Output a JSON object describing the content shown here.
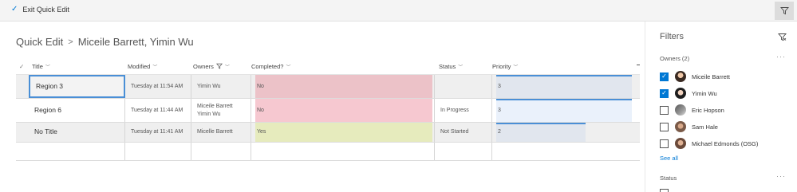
{
  "toolbar": {
    "exit_label": "Exit Quick Edit",
    "exit_icon": "check-icon",
    "filter_icon": "filter-icon"
  },
  "breadcrumb": {
    "root": "Quick Edit",
    "separator": ">",
    "current": "Miceile Barrett, Yimin Wu"
  },
  "grid": {
    "columns": [
      {
        "key": "title",
        "label": "Title"
      },
      {
        "key": "modified",
        "label": "Modified"
      },
      {
        "key": "owners",
        "label": "Owners"
      },
      {
        "key": "completed",
        "label": "Completed?"
      },
      {
        "key": "status",
        "label": "Status"
      },
      {
        "key": "priority",
        "label": "Priority"
      }
    ],
    "rows": [
      {
        "title": "Region 3",
        "modified": "Tuesday at 11:54 AM",
        "owners": [
          "Yimin Wu"
        ],
        "completed": "No",
        "status": "",
        "priority": "3",
        "priority_level": 1.0
      },
      {
        "title": "Region 6",
        "modified": "Tuesday at 11:44 AM",
        "owners": [
          "Miceile Barrett",
          "Yimin Wu"
        ],
        "completed": "No",
        "status": "In Progress",
        "priority": "3",
        "priority_level": 1.0
      },
      {
        "title": "No Title",
        "modified": "Tuesday at 11:41 AM",
        "owners": [
          "Micelle Barrett"
        ],
        "completed": "Yes",
        "status": "Not Started",
        "priority": "2",
        "priority_level": 0.66
      }
    ]
  },
  "filters": {
    "title": "Filters",
    "owners_section": "Owners (2)",
    "people": [
      {
        "name": "Miceile Barrett",
        "checked": true
      },
      {
        "name": "Yimin Wu",
        "checked": true
      },
      {
        "name": "Eric Hopson",
        "checked": false
      },
      {
        "name": "Sam Hale",
        "checked": false
      },
      {
        "name": "Michael Edmonds (OSG)",
        "checked": false
      }
    ],
    "see_all": "See all",
    "status_section": "Status",
    "more_icon": "more-icon"
  },
  "colors": {
    "accent": "#0078d4",
    "no_fill": "#f6c6cf",
    "yes_fill": "#e8ecbe",
    "priority_fill": "#e4ebf5"
  }
}
